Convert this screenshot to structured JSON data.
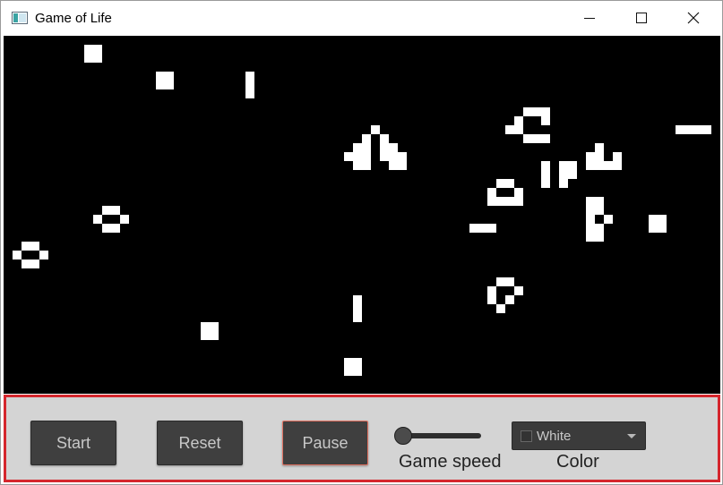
{
  "window": {
    "title": "Game of Life"
  },
  "controls": {
    "start_label": "Start",
    "reset_label": "Reset",
    "pause_label": "Pause",
    "speed_label": "Game speed",
    "speed_value": 0,
    "color_label": "Color",
    "color_selected": "White"
  },
  "colors": {
    "board_background": "#000000",
    "cell": "#ffffff",
    "panel_background": "#d4d4d4",
    "panel_border": "#d5262d",
    "button_background": "#3f3f3f",
    "pause_border": "#e07060"
  },
  "icons": {
    "app": "game-of-life-app-icon",
    "minimize": "minimize-icon",
    "maximize": "maximize-icon",
    "close": "close-icon",
    "dropdown": "chevron-down-icon"
  },
  "grid": {
    "columns": 80,
    "rows": 40,
    "live_cells": [
      [
        9,
        1
      ],
      [
        10,
        1
      ],
      [
        9,
        2
      ],
      [
        10,
        2
      ],
      [
        17,
        4
      ],
      [
        18,
        4
      ],
      [
        17,
        5
      ],
      [
        18,
        5
      ],
      [
        27,
        4
      ],
      [
        27,
        5
      ],
      [
        27,
        6
      ],
      [
        58,
        8
      ],
      [
        59,
        8
      ],
      [
        60,
        8
      ],
      [
        57,
        9
      ],
      [
        60,
        9
      ],
      [
        56,
        10
      ],
      [
        57,
        10
      ],
      [
        58,
        11
      ],
      [
        59,
        11
      ],
      [
        60,
        11
      ],
      [
        41,
        10
      ],
      [
        40,
        11
      ],
      [
        42,
        11
      ],
      [
        39,
        12
      ],
      [
        40,
        12
      ],
      [
        42,
        12
      ],
      [
        43,
        12
      ],
      [
        38,
        13
      ],
      [
        39,
        13
      ],
      [
        40,
        13
      ],
      [
        42,
        13
      ],
      [
        43,
        13
      ],
      [
        44,
        13
      ],
      [
        39,
        14
      ],
      [
        40,
        14
      ],
      [
        43,
        14
      ],
      [
        44,
        14
      ],
      [
        75,
        10
      ],
      [
        76,
        10
      ],
      [
        77,
        10
      ],
      [
        78,
        10
      ],
      [
        66,
        12
      ],
      [
        65,
        13
      ],
      [
        66,
        13
      ],
      [
        68,
        13
      ],
      [
        65,
        14
      ],
      [
        66,
        14
      ],
      [
        67,
        14
      ],
      [
        68,
        14
      ],
      [
        60,
        14
      ],
      [
        60,
        15
      ],
      [
        60,
        16
      ],
      [
        62,
        14
      ],
      [
        63,
        14
      ],
      [
        62,
        15
      ],
      [
        63,
        15
      ],
      [
        62,
        16
      ],
      [
        55,
        16
      ],
      [
        56,
        16
      ],
      [
        54,
        17
      ],
      [
        57,
        17
      ],
      [
        54,
        18
      ],
      [
        55,
        18
      ],
      [
        56,
        18
      ],
      [
        57,
        18
      ],
      [
        65,
        18
      ],
      [
        66,
        18
      ],
      [
        65,
        19
      ],
      [
        66,
        19
      ],
      [
        67,
        20
      ],
      [
        65,
        20
      ],
      [
        65,
        21
      ],
      [
        66,
        21
      ],
      [
        65,
        22
      ],
      [
        66,
        22
      ],
      [
        72,
        20
      ],
      [
        73,
        20
      ],
      [
        72,
        21
      ],
      [
        73,
        21
      ],
      [
        11,
        19
      ],
      [
        12,
        19
      ],
      [
        10,
        20
      ],
      [
        13,
        20
      ],
      [
        11,
        21
      ],
      [
        12,
        21
      ],
      [
        52,
        21
      ],
      [
        53,
        21
      ],
      [
        54,
        21
      ],
      [
        2,
        23
      ],
      [
        3,
        23
      ],
      [
        1,
        24
      ],
      [
        4,
        24
      ],
      [
        2,
        25
      ],
      [
        3,
        25
      ],
      [
        55,
        27
      ],
      [
        56,
        27
      ],
      [
        54,
        28
      ],
      [
        57,
        28
      ],
      [
        54,
        29
      ],
      [
        56,
        29
      ],
      [
        55,
        30
      ],
      [
        39,
        29
      ],
      [
        39,
        30
      ],
      [
        39,
        31
      ],
      [
        22,
        32
      ],
      [
        23,
        32
      ],
      [
        22,
        33
      ],
      [
        23,
        33
      ],
      [
        38,
        36
      ],
      [
        39,
        36
      ],
      [
        38,
        37
      ],
      [
        39,
        37
      ]
    ]
  }
}
